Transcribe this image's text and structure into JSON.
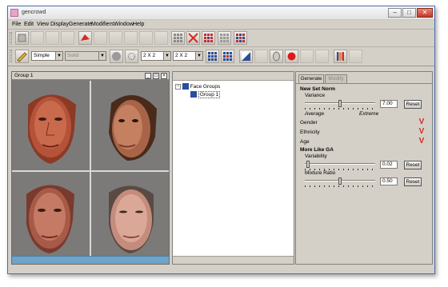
{
  "window": {
    "title": "gencrowd"
  },
  "menu": [
    "File",
    "Edit",
    "View",
    "Display",
    "Generate",
    "Modifiers",
    "Window",
    "Help"
  ],
  "toolbar2": {
    "mode_select": "Simple",
    "shading_select": "Solid",
    "grid_select_1": "2 X 2",
    "grid_select_2": "2 X 2"
  },
  "viewport": {
    "title": "Group 1"
  },
  "tree": {
    "root": "Face Groups",
    "child": "Group 1"
  },
  "tabs": {
    "generate": "Generate",
    "modify": "Modify"
  },
  "new_set": {
    "heading": "New Set Norm",
    "variance_label": "Variance",
    "variance_value": "7.00",
    "variance_fraction": 0.5,
    "min_label": "Average",
    "max_label": "Extreme",
    "reset": "Reset",
    "gender": "Gender",
    "ethnicity": "Ethnicity",
    "age": "Age",
    "check": "V"
  },
  "more_like": {
    "heading": "More Like GA",
    "variability_label": "Variability",
    "variability_value": "0.02",
    "variability_fraction": 0.02,
    "mixture_label": "Mixture Ratio",
    "mixture_value": "0.50",
    "mixture_fraction": 0.5,
    "reset": "Reset"
  },
  "colors": {
    "viewport_bg": "#7b7a78",
    "title_accent": "#d62a20",
    "scroll_blue": "#6fa3c8"
  }
}
